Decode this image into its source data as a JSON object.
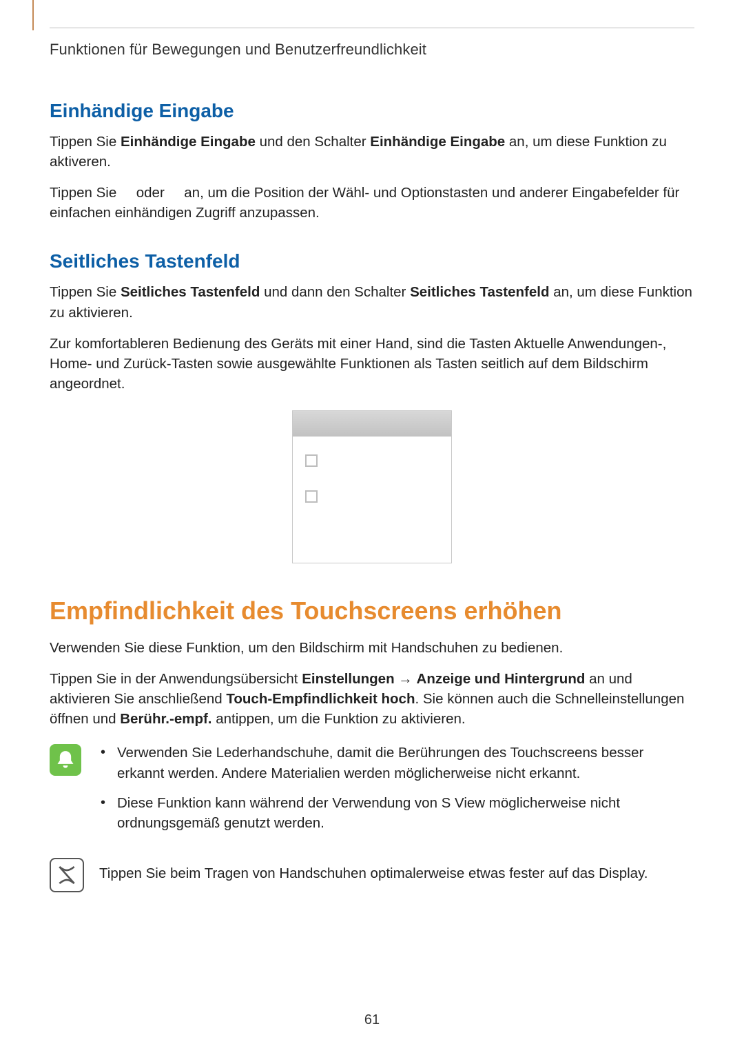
{
  "breadcrumb": "Funktionen für Bewegungen und Benutzerfreundlichkeit",
  "sections": {
    "onehand": {
      "title": "Einhändige Eingabe",
      "p1_a": "Tippen Sie ",
      "p1_b": "Einhändige Eingabe",
      "p1_c": " und den Schalter ",
      "p1_d": "Einhändige Eingabe",
      "p1_e": " an, um diese Funktion zu aktiveren.",
      "p2_a": "Tippen Sie ",
      "p2_b": " oder ",
      "p2_c": " an, um die Position der Wähl- und Optionstasten und anderer Eingabefelder für einfachen einhändigen Zugriff anzupassen."
    },
    "sidekey": {
      "title": "Seitliches Tastenfeld",
      "p1_a": "Tippen Sie ",
      "p1_b": "Seitliches Tastenfeld",
      "p1_c": " und dann den Schalter ",
      "p1_d": "Seitliches Tastenfeld",
      "p1_e": " an, um diese Funktion zu aktivieren.",
      "p2": "Zur komfortableren Bedienung des Geräts mit einer Hand, sind die Tasten Aktuelle Anwendungen-, Home- und Zurück-Tasten sowie ausgewählte Funktionen als Tasten seitlich auf dem Bildschirm angeordnet."
    },
    "touch": {
      "title": "Empfindlichkeit des Touchscreens erhöhen",
      "p1": "Verwenden Sie diese Funktion, um den Bildschirm mit Handschuhen zu bedienen.",
      "p2_a": "Tippen Sie in der Anwendungsübersicht ",
      "p2_b": "Einstellungen",
      "p2_arrow": " → ",
      "p2_c": "Anzeige und Hintergrund",
      "p2_d": " an und aktivieren Sie anschließend ",
      "p2_e": "Touch-Empfindlichkeit hoch",
      "p2_f": ". Sie können auch die Schnelleinstellungen öffnen und ",
      "p2_g": "Berühr.-empf.",
      "p2_h": " antippen, um die Funktion zu aktivieren.",
      "bullets": [
        "Verwenden Sie Lederhandschuhe, damit die Berührungen des Touchscreens besser erkannt werden. Andere Materialien werden möglicherweise nicht erkannt.",
        "Diese Funktion kann während der Verwendung von S View möglicherweise nicht ordnungsgemäß genutzt werden."
      ],
      "note": "Tippen Sie beim Tragen von Handschuhen optimalerweise etwas fester auf das Display."
    }
  },
  "page_number": "61"
}
